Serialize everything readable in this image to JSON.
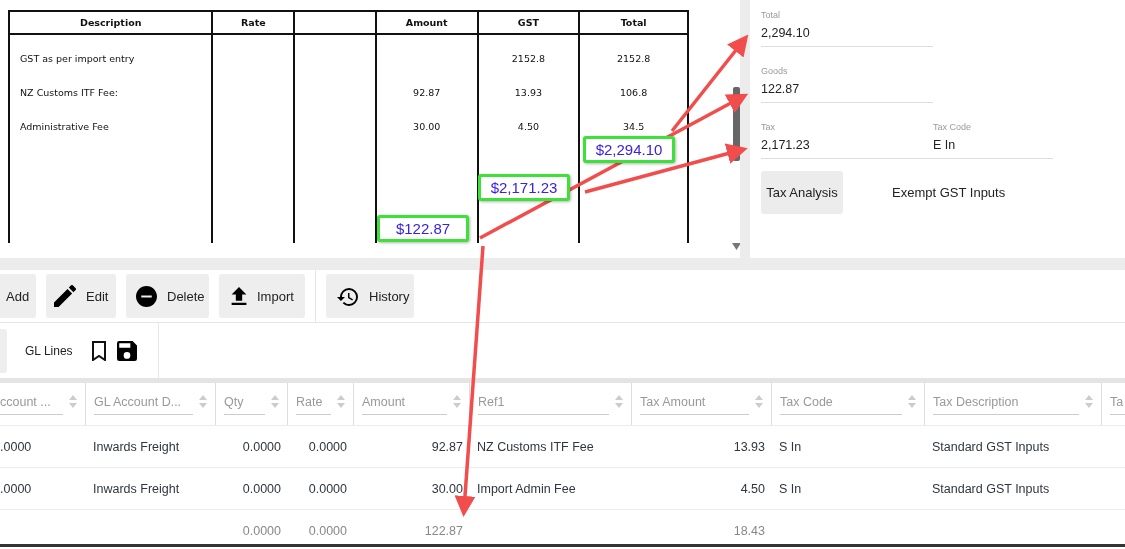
{
  "invoice": {
    "headings": {
      "description": "Description",
      "rate": "Rate",
      "amount": "Amount",
      "gst": "GST",
      "total": "Total"
    },
    "rows": [
      {
        "description": "GST as per import entry",
        "gst": "2152.8",
        "total": "2152.8"
      },
      {
        "description": "NZ Customs ITF Fee:",
        "amount": "92.87",
        "gst": "13.93",
        "total": "106.8"
      },
      {
        "description": "Administrative Fee",
        "amount": "30.00",
        "gst": "4.50",
        "total": "34.5"
      }
    ]
  },
  "callouts": [
    {
      "text": "$2,294.10"
    },
    {
      "text": "$2,171.23"
    },
    {
      "text": "$122.87"
    }
  ],
  "summary": {
    "fields": [
      {
        "label": "Total",
        "value": "2,294.10"
      },
      {
        "label": "Goods",
        "value": "122.87"
      },
      {
        "label": "Tax",
        "value": "2,171.23"
      },
      {
        "label": "Tax Code",
        "value": "E In"
      }
    ],
    "button": "Tax Analysis",
    "tax_code_description": "Exempt GST Inputs"
  },
  "toolbar": [
    {
      "kind": "add",
      "label": "Add"
    },
    {
      "kind": "edit",
      "label": "Edit"
    },
    {
      "kind": "delete",
      "label": "Delete"
    },
    {
      "kind": "import",
      "label": "Import"
    },
    {
      "kind": "history",
      "label": "History"
    }
  ],
  "gl_lines": {
    "label": "GL Lines"
  },
  "grid": {
    "columns": [
      "ccount ...",
      "GL Account D...",
      "Qty",
      "Rate",
      "Amount",
      "Ref1",
      "Tax Amount",
      "Tax Code",
      "Tax Description",
      "Ta"
    ],
    "rows": [
      {
        "account": ".0000",
        "gl_desc": "Inwards Freight",
        "qty": "0.0000",
        "rate": "0.0000",
        "amount": "92.87",
        "ref1": "NZ Customs ITF Fee",
        "tax_amount": "13.93",
        "tax_code": "S In",
        "tax_desc": "Standard GST Inputs"
      },
      {
        "account": ".0000",
        "gl_desc": "Inwards Freight",
        "qty": "0.0000",
        "rate": "0.0000",
        "amount": "30.00",
        "ref1": "Import Admin Fee",
        "tax_amount": "4.50",
        "tax_code": "S In",
        "tax_desc": "Standard GST Inputs"
      }
    ],
    "totals": {
      "qty": "0.0000",
      "rate": "0.0000",
      "amount": "122.87",
      "tax_amount": "18.43"
    }
  }
}
